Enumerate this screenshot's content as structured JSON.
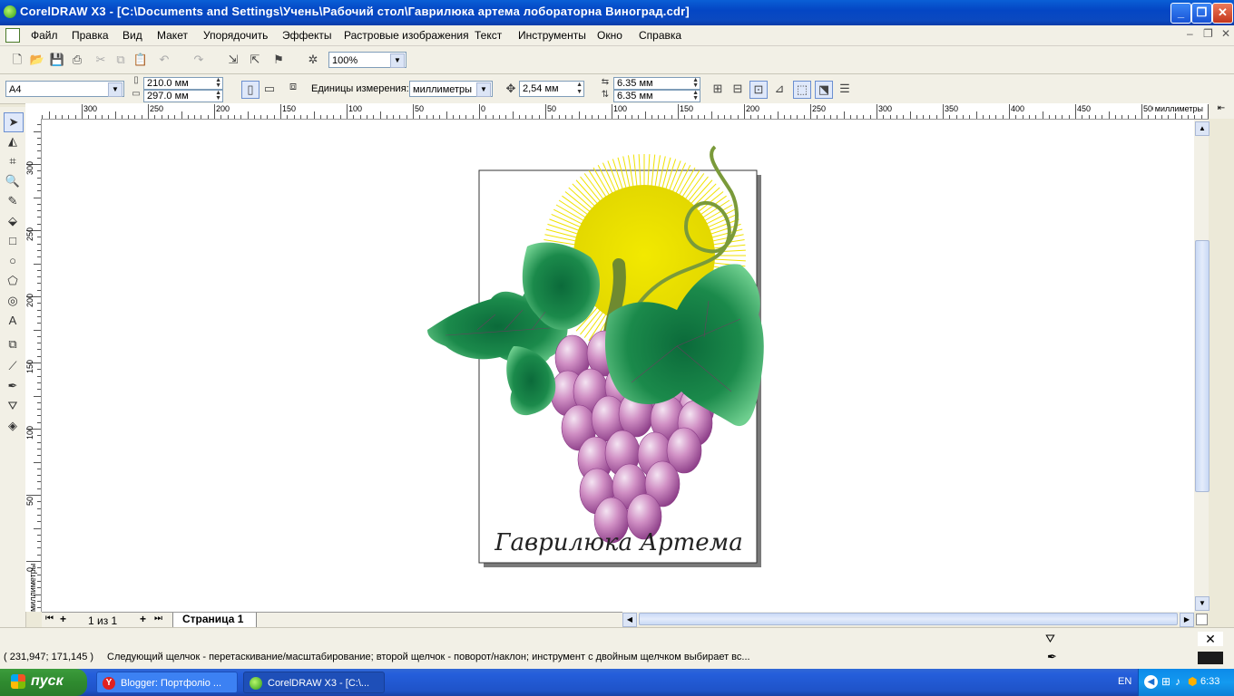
{
  "window": {
    "title": "CorelDRAW X3 - [C:\\Documents and Settings\\Учень\\Рабочий стол\\Гаврилюка артема лобораторна Виноград.cdr]",
    "minimize": "_",
    "restore": "❐",
    "close": "✕"
  },
  "menu": [
    "Файл",
    "Правка",
    "Вид",
    "Макет",
    "Упорядочить",
    "Эффекты",
    "Растровые изображения",
    "Текст",
    "Инструменты",
    "Окно",
    "Справка"
  ],
  "toolbar": {
    "zoom": "100%"
  },
  "property_bar": {
    "paper": "A4",
    "width": "210.0 мм",
    "height": "297.0 мм",
    "units_label": "Единицы измерения:",
    "units_value": "миллиметры",
    "nudge": "2,54 мм",
    "dup_x": "6.35 мм",
    "dup_y": "6.35 мм"
  },
  "rulers": {
    "unit": "миллиметры",
    "h_ticks": [
      "300",
      "250",
      "200",
      "150",
      "100",
      "50",
      "0",
      "50",
      "100",
      "150",
      "200",
      "250",
      "300",
      "350",
      "400",
      "450",
      "500"
    ],
    "v_ticks": [
      "300",
      "250",
      "200",
      "150",
      "100",
      "50",
      "0"
    ]
  },
  "document": {
    "signature": "Гаврилюка Артема"
  },
  "pages": {
    "counter": "1 из 1",
    "tab": "Страница 1"
  },
  "status": {
    "coords": "( 231,947; 171,145 )",
    "hint": "Следующий щелчок - перетаскивание/масштабирование; второй щелчок - поворот/наклон; инструмент с двойным щелчком выбирает вс..."
  },
  "taskbar": {
    "start": "пуск",
    "tasks": [
      "Blogger: Портфоліо ...",
      "CorelDRAW X3 - [C:\\..."
    ],
    "lang": "EN",
    "clock": "6:33"
  },
  "colors": {
    "titlebar": "#0a5fd6",
    "grape": "#c77bb8",
    "leaf": "#1e8a4a",
    "sun": "#e8e000"
  }
}
